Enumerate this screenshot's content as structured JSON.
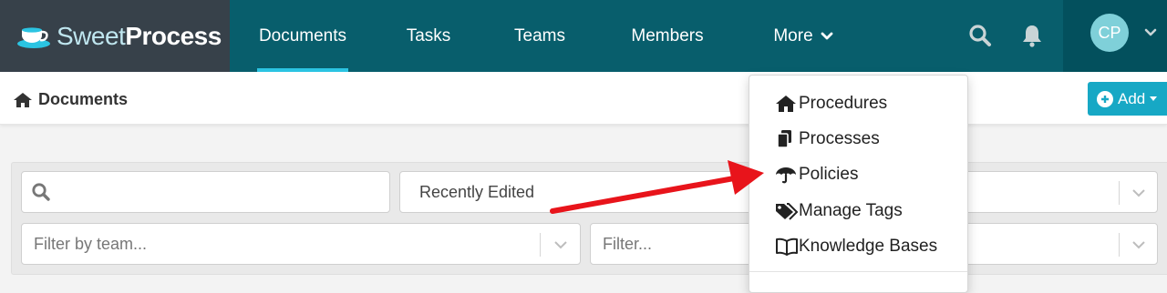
{
  "brand": {
    "name_light": "Sweet",
    "name_bold": "Process"
  },
  "nav": {
    "items": [
      {
        "label": "Documents"
      },
      {
        "label": "Tasks"
      },
      {
        "label": "Teams"
      },
      {
        "label": "Members"
      },
      {
        "label": "More"
      }
    ],
    "search_icon": "search-icon",
    "bell_icon": "bell-icon"
  },
  "user": {
    "initials": "CP"
  },
  "subheader": {
    "title": "Documents",
    "add_label": "Add"
  },
  "filters": {
    "search_placeholder": "",
    "sort_value": "Recently Edited",
    "team_placeholder": "Filter by team...",
    "filter_placeholder": "Filter..."
  },
  "more_menu": {
    "items": [
      {
        "label": "Procedures",
        "icon": "home-icon"
      },
      {
        "label": "Processes",
        "icon": "copy-icon"
      },
      {
        "label": "Policies",
        "icon": "umbrella-icon"
      },
      {
        "label": "Manage Tags",
        "icon": "tags-icon"
      },
      {
        "label": "Knowledge Bases",
        "icon": "book-icon"
      }
    ]
  },
  "colors": {
    "nav_bg": "#085e6c",
    "brand_bg": "#37414a",
    "accent": "#2bc4e2",
    "add_button": "#17a8c5",
    "annotation_arrow": "#e8141b"
  }
}
